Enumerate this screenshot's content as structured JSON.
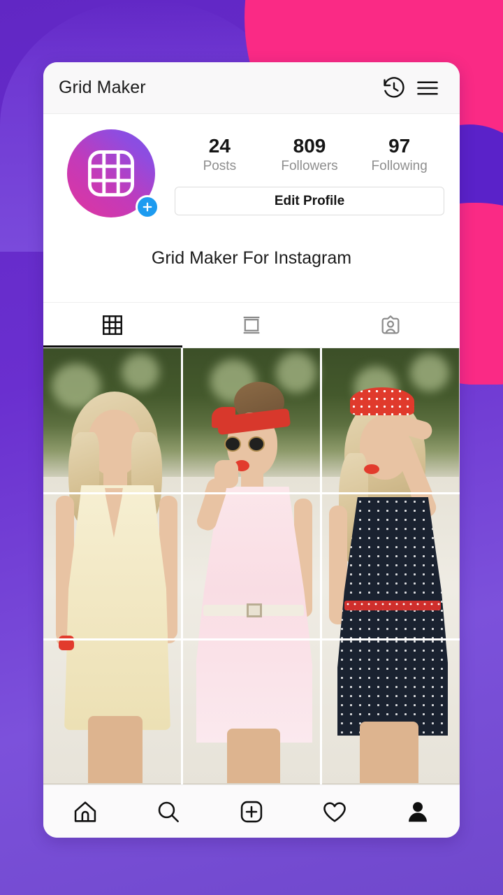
{
  "background": {
    "purple": "#6127c4",
    "purple_light": "#7c51db",
    "pink": "#fa2a85"
  },
  "appbar": {
    "title": "Grid Maker",
    "history_icon": "history-clock-icon",
    "menu_icon": "hamburger-menu-icon"
  },
  "profile": {
    "avatar_icon": "grid-logo-icon",
    "avatar_badge_icon": "plus-icon",
    "avatar_gradient_from": "#e0359e",
    "avatar_gradient_to": "#7a52e8",
    "badge_color": "#1d9bf0",
    "stats": [
      {
        "value": "24",
        "label": "Posts"
      },
      {
        "value": "809",
        "label": "Followers"
      },
      {
        "value": "97",
        "label": "Following"
      }
    ],
    "edit_button_label": "Edit Profile",
    "display_name": "Grid Maker For Instagram"
  },
  "tabs": [
    {
      "name": "grid",
      "icon": "grid-tab-icon",
      "active": true
    },
    {
      "name": "reels",
      "icon": "carousel-tab-icon",
      "active": false
    },
    {
      "name": "tagged",
      "icon": "tagged-tab-icon",
      "active": false
    }
  ],
  "grid": {
    "columns": 3,
    "rows": 3,
    "cells": [
      {
        "position": "top-left",
        "content": "blonde woman smiling, head and shoulders"
      },
      {
        "position": "top-center",
        "content": "woman with red bandana and round sunglasses"
      },
      {
        "position": "top-right",
        "content": "woman with red polka-dot bow, hands in hair"
      },
      {
        "position": "middle-left",
        "content": "cream v-neck sleeveless dress torso"
      },
      {
        "position": "middle-center",
        "content": "pink striped shirt dress with white belt"
      },
      {
        "position": "middle-right",
        "content": "navy polka-dot dress with red belt"
      },
      {
        "position": "bottom-left",
        "content": "cream skirt and hand with red nails"
      },
      {
        "position": "bottom-center",
        "content": "pink skirt hem and legs"
      },
      {
        "position": "bottom-right",
        "content": "navy polka-dot skirt and legs"
      }
    ]
  },
  "bottom_nav": [
    {
      "name": "home",
      "icon": "home-icon",
      "active": false
    },
    {
      "name": "search",
      "icon": "search-icon",
      "active": false
    },
    {
      "name": "add",
      "icon": "plus-square-icon",
      "active": false
    },
    {
      "name": "activity",
      "icon": "heart-icon",
      "active": false
    },
    {
      "name": "profile",
      "icon": "person-filled-icon",
      "active": true
    }
  ]
}
